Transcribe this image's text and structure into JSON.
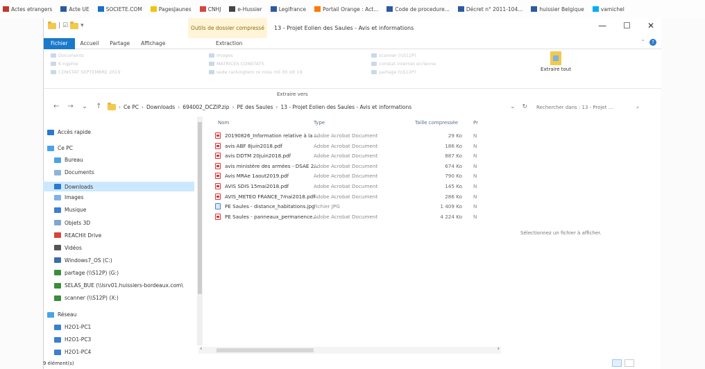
{
  "bookmarks": [
    {
      "label": "Actes etrangers",
      "icon": "red-flag-icon",
      "color": "#c0392b"
    },
    {
      "label": "Acte UE",
      "icon": "blue-square-icon",
      "color": "#2c5aa0"
    },
    {
      "label": "SOCIETE.COM",
      "icon": "info-circle-icon",
      "color": "#1c6fc2"
    },
    {
      "label": "PagesJaunes",
      "icon": "smiley-icon",
      "color": "#f1c40f"
    },
    {
      "label": "CNHJ",
      "icon": "bird-icon",
      "color": "#d64541"
    },
    {
      "label": "e-Hussier",
      "icon": "globe-icon",
      "color": "#444444"
    },
    {
      "label": "Legifrance",
      "icon": "french-flag-icon",
      "color": "#2c5aa0"
    },
    {
      "label": "Portail Orange : Act...",
      "icon": "orange-square-icon",
      "color": "#ff7900"
    },
    {
      "label": "Code de procedure...",
      "icon": "french-flag-icon",
      "color": "#2c5aa0"
    },
    {
      "label": "Décret n° 2011-104...",
      "icon": "french-flag-icon",
      "color": "#2c5aa0"
    },
    {
      "label": "huissier Belgique",
      "icon": "blue-square-icon",
      "color": "#2c5aa0"
    },
    {
      "label": "vamichel",
      "icon": "skype-icon",
      "color": "#00aff0"
    }
  ],
  "window": {
    "contextual_tab": "Outils de dossier compressé",
    "title": "13 - Projet Eolien des Saules - Avis et informations",
    "minimize": "—",
    "maximize": "☐",
    "close": "✕",
    "help": "?"
  },
  "ribbon_tabs": {
    "file": "Fichier",
    "home": "Accueil",
    "share": "Partage",
    "view": "Affichage",
    "extract": "Extraction"
  },
  "ribbon": {
    "items": [
      "Documents",
      "K:ngphie",
      "CONSTAT SEPTEMBRE 2019",
      "Images",
      "MATRICES CONSTATS",
      "sede rackingtem re miss mli 30 ott 19",
      "scanner (\\\\S12P)",
      "constat internet ecrienne",
      "partage (\\\\S12P)"
    ],
    "extract_all": "Extraire tout",
    "group_label": "Extraire vers"
  },
  "address": {
    "crumbs": [
      "Ce PC",
      "Downloads",
      "694002_DCZIP.zip",
      "PE des Saules",
      "13 - Projet Eolien des Saules - Avis et informations"
    ],
    "search_placeholder": "Rechercher dans : 13 - Projet ..."
  },
  "nav": {
    "quick_access": "Accès rapide",
    "this_pc": "Ce PC",
    "items": [
      "Bureau",
      "Documents",
      "Downloads",
      "Images",
      "Musique",
      "Objets 3D",
      "REACHit Drive",
      "Vidéos",
      "Windows7_OS (C:)",
      "partage (\\\\S12P) (G:)",
      "SELAS_BUE (\\\\lsrv01.huissiers-bordeaux.com\\",
      "scanner (\\\\S12P) (X:)"
    ],
    "network": "Réseau",
    "network_items": [
      "H2O1-PC1",
      "H2O1-PC3",
      "H2O1-PC4"
    ]
  },
  "columns": {
    "name": "Nom",
    "type": "Type",
    "size": "Taille compressée",
    "ratio": "Pr"
  },
  "files": [
    {
      "name": "20190826_Information relative à la ...",
      "type": "Adobe Acrobat Document",
      "size": "29 Ko",
      "ratio": "N",
      "kind": "pdf"
    },
    {
      "name": "avis ABF 8juin2018.pdf",
      "type": "Adobe Acrobat Document",
      "size": "186 Ko",
      "ratio": "N",
      "kind": "pdf"
    },
    {
      "name": "avis DDTM 20juin2018.pdf",
      "type": "Adobe Acrobat Document",
      "size": "887 Ko",
      "ratio": "N",
      "kind": "pdf"
    },
    {
      "name": "avis ministère des armées - DSAE 2...",
      "type": "Adobe Acrobat Document",
      "size": "674 Ko",
      "ratio": "N",
      "kind": "pdf"
    },
    {
      "name": "Avis MRAe 1aout2019.pdf",
      "type": "Adobe Acrobat Document",
      "size": "790 Ko",
      "ratio": "N",
      "kind": "pdf"
    },
    {
      "name": "AVIS SDIS 15mai2018.pdf",
      "type": "Adobe Acrobat Document",
      "size": "145 Ko",
      "ratio": "N",
      "kind": "pdf"
    },
    {
      "name": "AVIS_METEO FRANCE_7mai2018.pdf",
      "type": "Adobe Acrobat Document",
      "size": "286 Ko",
      "ratio": "N",
      "kind": "pdf"
    },
    {
      "name": "PE Saules - distance_habitations.jpg",
      "type": "Fichier JPG",
      "size": "1 409 Ko",
      "ratio": "N",
      "kind": "jpg"
    },
    {
      "name": "PE Saules - panneaux_permanence....",
      "type": "Adobe Acrobat Document",
      "size": "4 224 Ko",
      "ratio": "N",
      "kind": "pdf"
    }
  ],
  "preview_text": "Sélectionnez un fichier à afficher.",
  "status": "9 élément(s)"
}
